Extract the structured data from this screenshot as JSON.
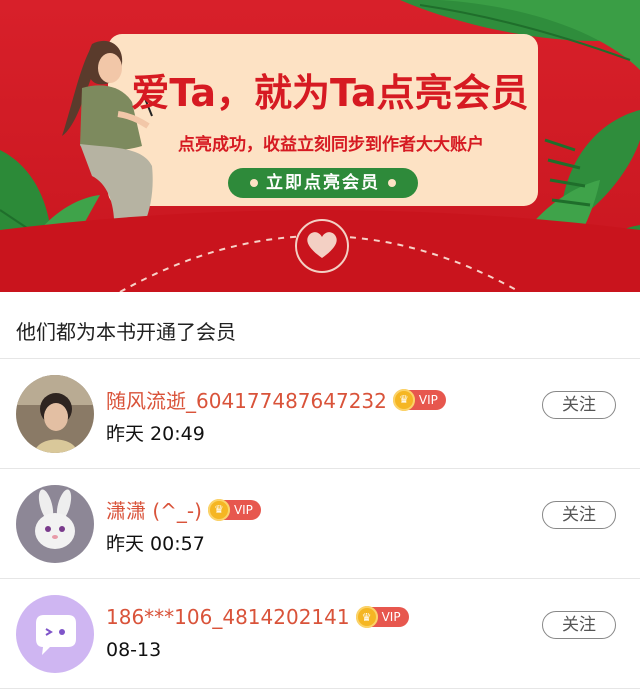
{
  "banner": {
    "headline": "爱Ta，就为Ta点亮会员",
    "subline": "点亮成功，收益立刻同步到作者大大账户",
    "cta_label": "立即点亮会员",
    "colors": {
      "background": "#d8202a",
      "card": "#fde2c4",
      "accent": "#d61a22",
      "cta": "#2e8a3a"
    }
  },
  "section": {
    "title": "他们都为本书开通了会员"
  },
  "members": [
    {
      "name": "随风流逝_604177487647232",
      "badge": "VIP",
      "time": "昨天 20:49",
      "follow_label": "关注",
      "avatar_icon": "photo-avatar-girl"
    },
    {
      "name": "潇潇 (^_-)",
      "badge": "VIP",
      "time": "昨天 00:57",
      "follow_label": "关注",
      "avatar_icon": "rabbit-avatar"
    },
    {
      "name": "186***106_4814202141",
      "badge": "VIP",
      "time": "08-13",
      "follow_label": "关注",
      "avatar_icon": "default-chat-avatar"
    }
  ]
}
